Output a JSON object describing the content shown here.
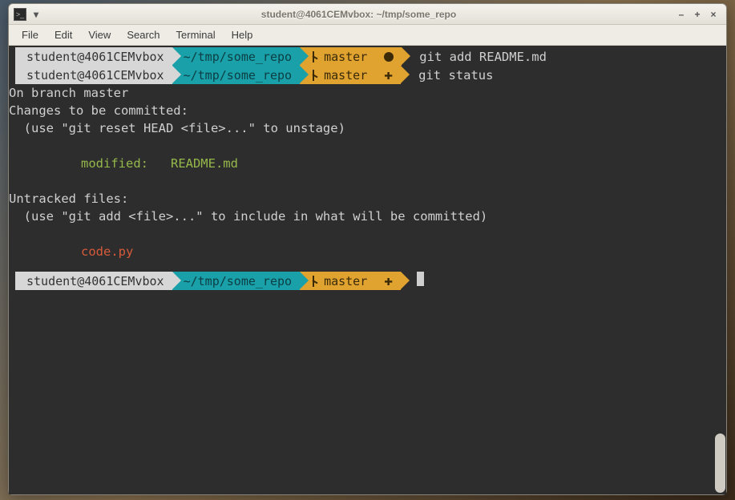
{
  "window": {
    "title": "student@4061CEMvbox: ~/tmp/some_repo",
    "buttons": {
      "min": "–",
      "max": "+",
      "close": "×"
    },
    "pin": "▾"
  },
  "menubar": [
    "File",
    "Edit",
    "View",
    "Search",
    "Terminal",
    "Help"
  ],
  "prompt": {
    "user": "student@4061CEMvbox",
    "path": "~/tmp/some_repo",
    "branch": "master"
  },
  "commands": {
    "cmd1": "git add README.md",
    "cmd2": "git status"
  },
  "output": {
    "l1": "On branch master",
    "l2": "Changes to be committed:",
    "l3": "  (use \"git reset HEAD <file>...\" to unstage)",
    "l4": "modified:   README.md",
    "l5": "Untracked files:",
    "l6": "  (use \"git add <file>...\" to include in what will be committed)",
    "l7": "code.py"
  }
}
